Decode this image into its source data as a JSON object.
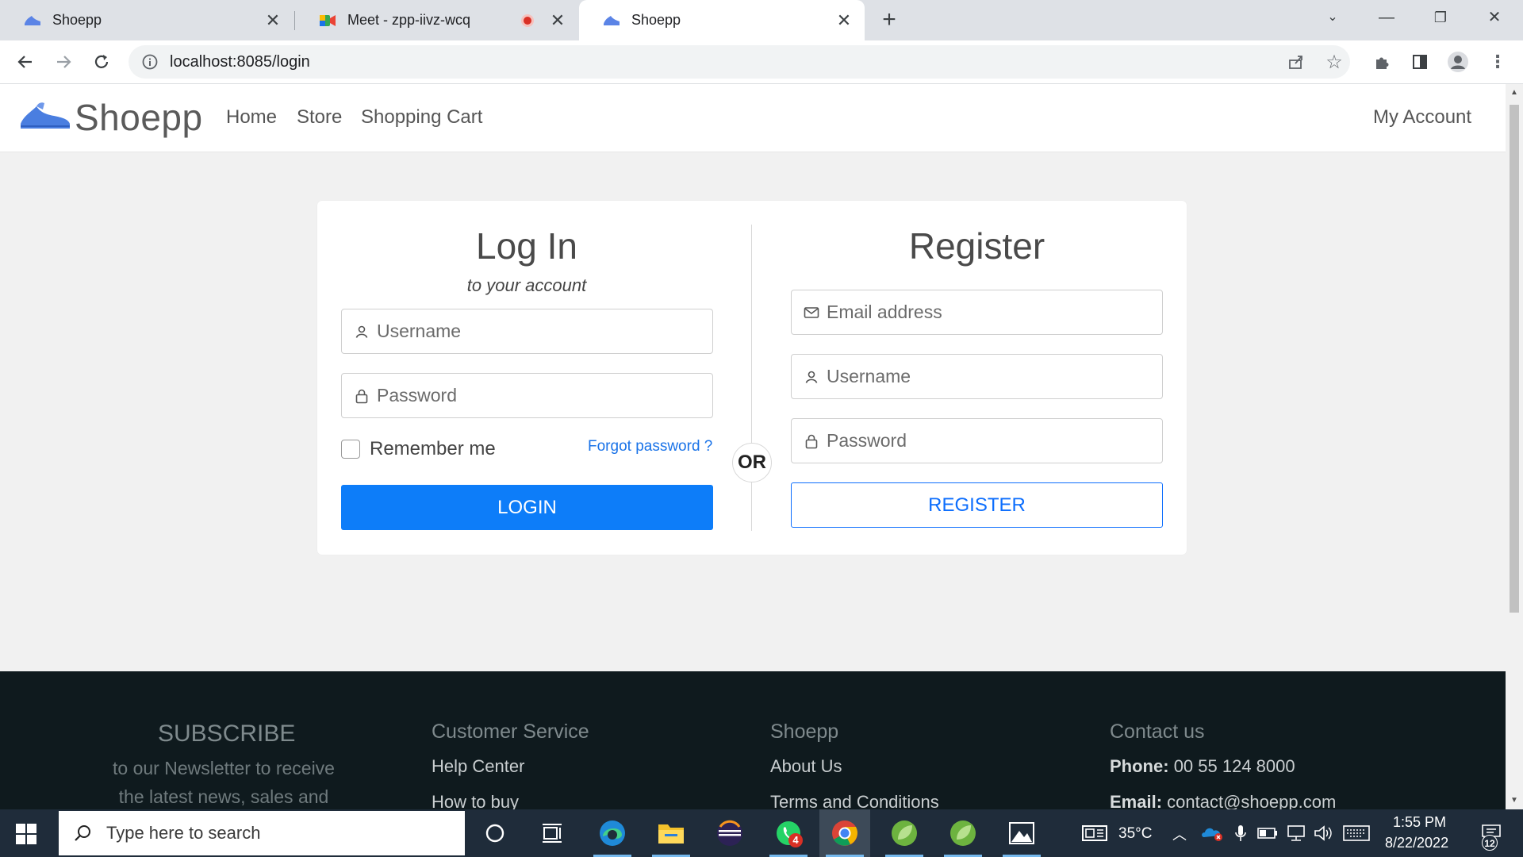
{
  "browser": {
    "tabs": [
      {
        "title": "Shoepp",
        "favicon": "shoe-icon",
        "active": false
      },
      {
        "title": "Meet - zpp-iivz-wcq",
        "favicon": "google-meet-icon",
        "active": false,
        "recording": true
      },
      {
        "title": "Shoepp",
        "favicon": "shoe-icon",
        "active": true
      }
    ],
    "address": {
      "url": "localhost:8085/login"
    }
  },
  "site": {
    "brand": "Shoepp",
    "nav": {
      "home": "Home",
      "store": "Store",
      "cart": "Shopping Cart",
      "account": "My Account"
    }
  },
  "login": {
    "title": "Log In",
    "subtitle": "to your account",
    "username_placeholder": "Username",
    "password_placeholder": "Password",
    "remember_label": "Remember me",
    "forgot_label": "Forgot password ?",
    "button_label": "LOGIN"
  },
  "divider_label": "OR",
  "register": {
    "title": "Register",
    "email_placeholder": "Email address",
    "username_placeholder": "Username",
    "password_placeholder": "Password",
    "button_label": "REGISTER"
  },
  "footer": {
    "subscribe": {
      "title": "SUBSCRIBE",
      "line1": "to our Newsletter to receive",
      "line2": "the latest news, sales and"
    },
    "customer_service": {
      "title": "Customer Service",
      "links": [
        "Help Center",
        "How to buy"
      ]
    },
    "shoepp": {
      "title": "Shoepp",
      "links": [
        "About Us",
        "Terms and Conditions"
      ]
    },
    "contact": {
      "title": "Contact us",
      "phone_label": "Phone:",
      "phone": "00 55 124 8000",
      "email_label": "Email:",
      "email": "contact@shoepp.com"
    }
  },
  "taskbar": {
    "search_placeholder": "Type here to search",
    "whatsapp_badge": "4",
    "temperature": "35°C",
    "time": "1:55 PM",
    "date": "8/22/2022",
    "notifications": "12"
  },
  "colors": {
    "primary": "#0d7df9",
    "brand_icon": "#4a7ee0",
    "footer_bg": "#0f1a1e"
  }
}
